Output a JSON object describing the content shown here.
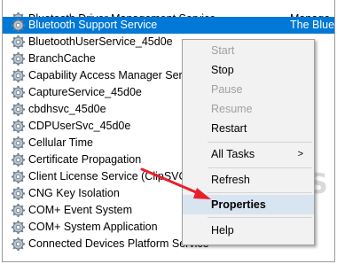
{
  "services": [
    {
      "name": "Bluetooth Driver Management Service",
      "desc": "Manage",
      "selected": false
    },
    {
      "name": "Bluetooth Support Service",
      "desc": "The Blue",
      "selected": true
    },
    {
      "name": "BluetoothUserService_45d0e",
      "desc": "",
      "selected": false
    },
    {
      "name": "BranchCache",
      "desc": "",
      "selected": false
    },
    {
      "name": "Capability Access Manager Servi",
      "desc": "",
      "selected": false
    },
    {
      "name": "CaptureService_45d0e",
      "desc": "",
      "selected": false
    },
    {
      "name": "cbdhsvc_45d0e",
      "desc": "",
      "selected": false
    },
    {
      "name": "CDPUserSvc_45d0e",
      "desc": "",
      "selected": false
    },
    {
      "name": "Cellular Time",
      "desc": "",
      "selected": false
    },
    {
      "name": "Certificate Propagation",
      "desc": "",
      "selected": false
    },
    {
      "name": "Client License Service (ClipSVC",
      "desc": "",
      "selected": false
    },
    {
      "name": "CNG Key Isolation",
      "desc": "",
      "selected": false
    },
    {
      "name": "COM+ Event System",
      "desc": "",
      "selected": false
    },
    {
      "name": "COM+ System Application",
      "desc": "",
      "selected": false
    },
    {
      "name": "Connected Devices Platform Service",
      "desc": "",
      "selected": false
    }
  ],
  "context_menu": {
    "start": "Start",
    "stop": "Stop",
    "pause": "Pause",
    "resume": "Resume",
    "restart": "Restart",
    "all_tasks": "All Tasks",
    "all_tasks_arrow": ">",
    "refresh": "Refresh",
    "properties": "Properties",
    "help": "Help"
  },
  "watermark": "A  PUALS",
  "colors": {
    "selection": "#0078d7",
    "menu_bg": "#f2f2f2",
    "hover": "#d9e4f1",
    "arrow": "#e8202a",
    "disabled_text": "#a0a0a0"
  }
}
